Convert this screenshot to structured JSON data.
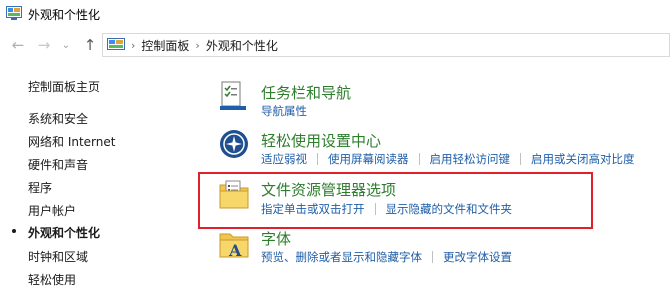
{
  "window": {
    "title": "外观和个性化"
  },
  "nav": {
    "back_icon": "back-arrow-icon",
    "forward_icon": "forward-arrow-icon",
    "recent_icon": "chevron-down-icon",
    "up_icon": "up-arrow-icon",
    "breadcrumb": [
      "控制面板",
      "外观和个性化"
    ]
  },
  "sidebar": {
    "items": [
      {
        "label": "控制面板主页"
      },
      {
        "label": "系统和安全"
      },
      {
        "label": "网络和 Internet"
      },
      {
        "label": "硬件和声音"
      },
      {
        "label": "程序"
      },
      {
        "label": "用户帐户"
      },
      {
        "label": "外观和个性化",
        "active": true
      },
      {
        "label": "时钟和区域"
      },
      {
        "label": "轻松使用"
      }
    ]
  },
  "categories": [
    {
      "title": "任务栏和导航",
      "icon": "taskbar-checklist-icon",
      "links": [
        "导航属性"
      ]
    },
    {
      "title": "轻松使用设置中心",
      "icon": "ease-of-access-icon",
      "links": [
        "适应弱视",
        "使用屏幕阅读器",
        "启用轻松访问键",
        "启用或关闭高对比度"
      ]
    },
    {
      "title": "文件资源管理器选项",
      "icon": "folder-options-icon",
      "links": [
        "指定单击或双击打开",
        "显示隐藏的文件和文件夹"
      ]
    },
    {
      "title": "字体",
      "icon": "fonts-folder-icon",
      "links": [
        "预览、删除或者显示和隐藏字体",
        "更改字体设置"
      ]
    }
  ],
  "colors": {
    "category_title": "#2d7d2d",
    "link": "#1f5ea8",
    "highlight": "#e0202a"
  }
}
